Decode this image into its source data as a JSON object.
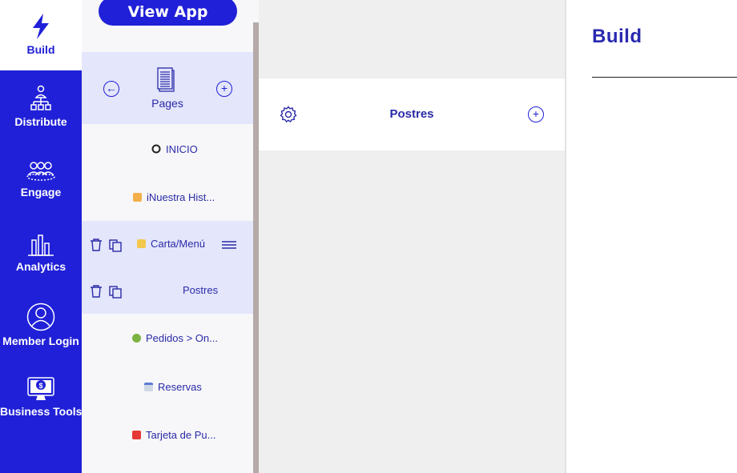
{
  "sidebar": {
    "items": [
      {
        "label": "Build",
        "icon": "lightning-icon"
      },
      {
        "label": "Distribute",
        "icon": "org-chart-icon"
      },
      {
        "label": "Engage",
        "icon": "users-icon"
      },
      {
        "label": "Analytics",
        "icon": "bar-chart-icon"
      },
      {
        "label": "Member Login",
        "icon": "user-circle-icon"
      },
      {
        "label": "Business Tools",
        "icon": "monitor-dollar-icon"
      }
    ]
  },
  "header": {
    "view_app_label": "View App"
  },
  "pages": {
    "title": "Pages",
    "items": [
      {
        "label": "INICIO"
      },
      {
        "label": "iNuestra Hist..."
      },
      {
        "label": "Carta/Menú"
      },
      {
        "label": "Postres"
      },
      {
        "label": "Pedidos > On..."
      },
      {
        "label": "Reservas"
      },
      {
        "label": "Tarjeta de Pu..."
      }
    ]
  },
  "subpage": {
    "title": "Postres"
  },
  "right": {
    "title": "Build"
  },
  "colors": {
    "brand": "#2020d8",
    "selected_bg": "#e4e6fb"
  }
}
